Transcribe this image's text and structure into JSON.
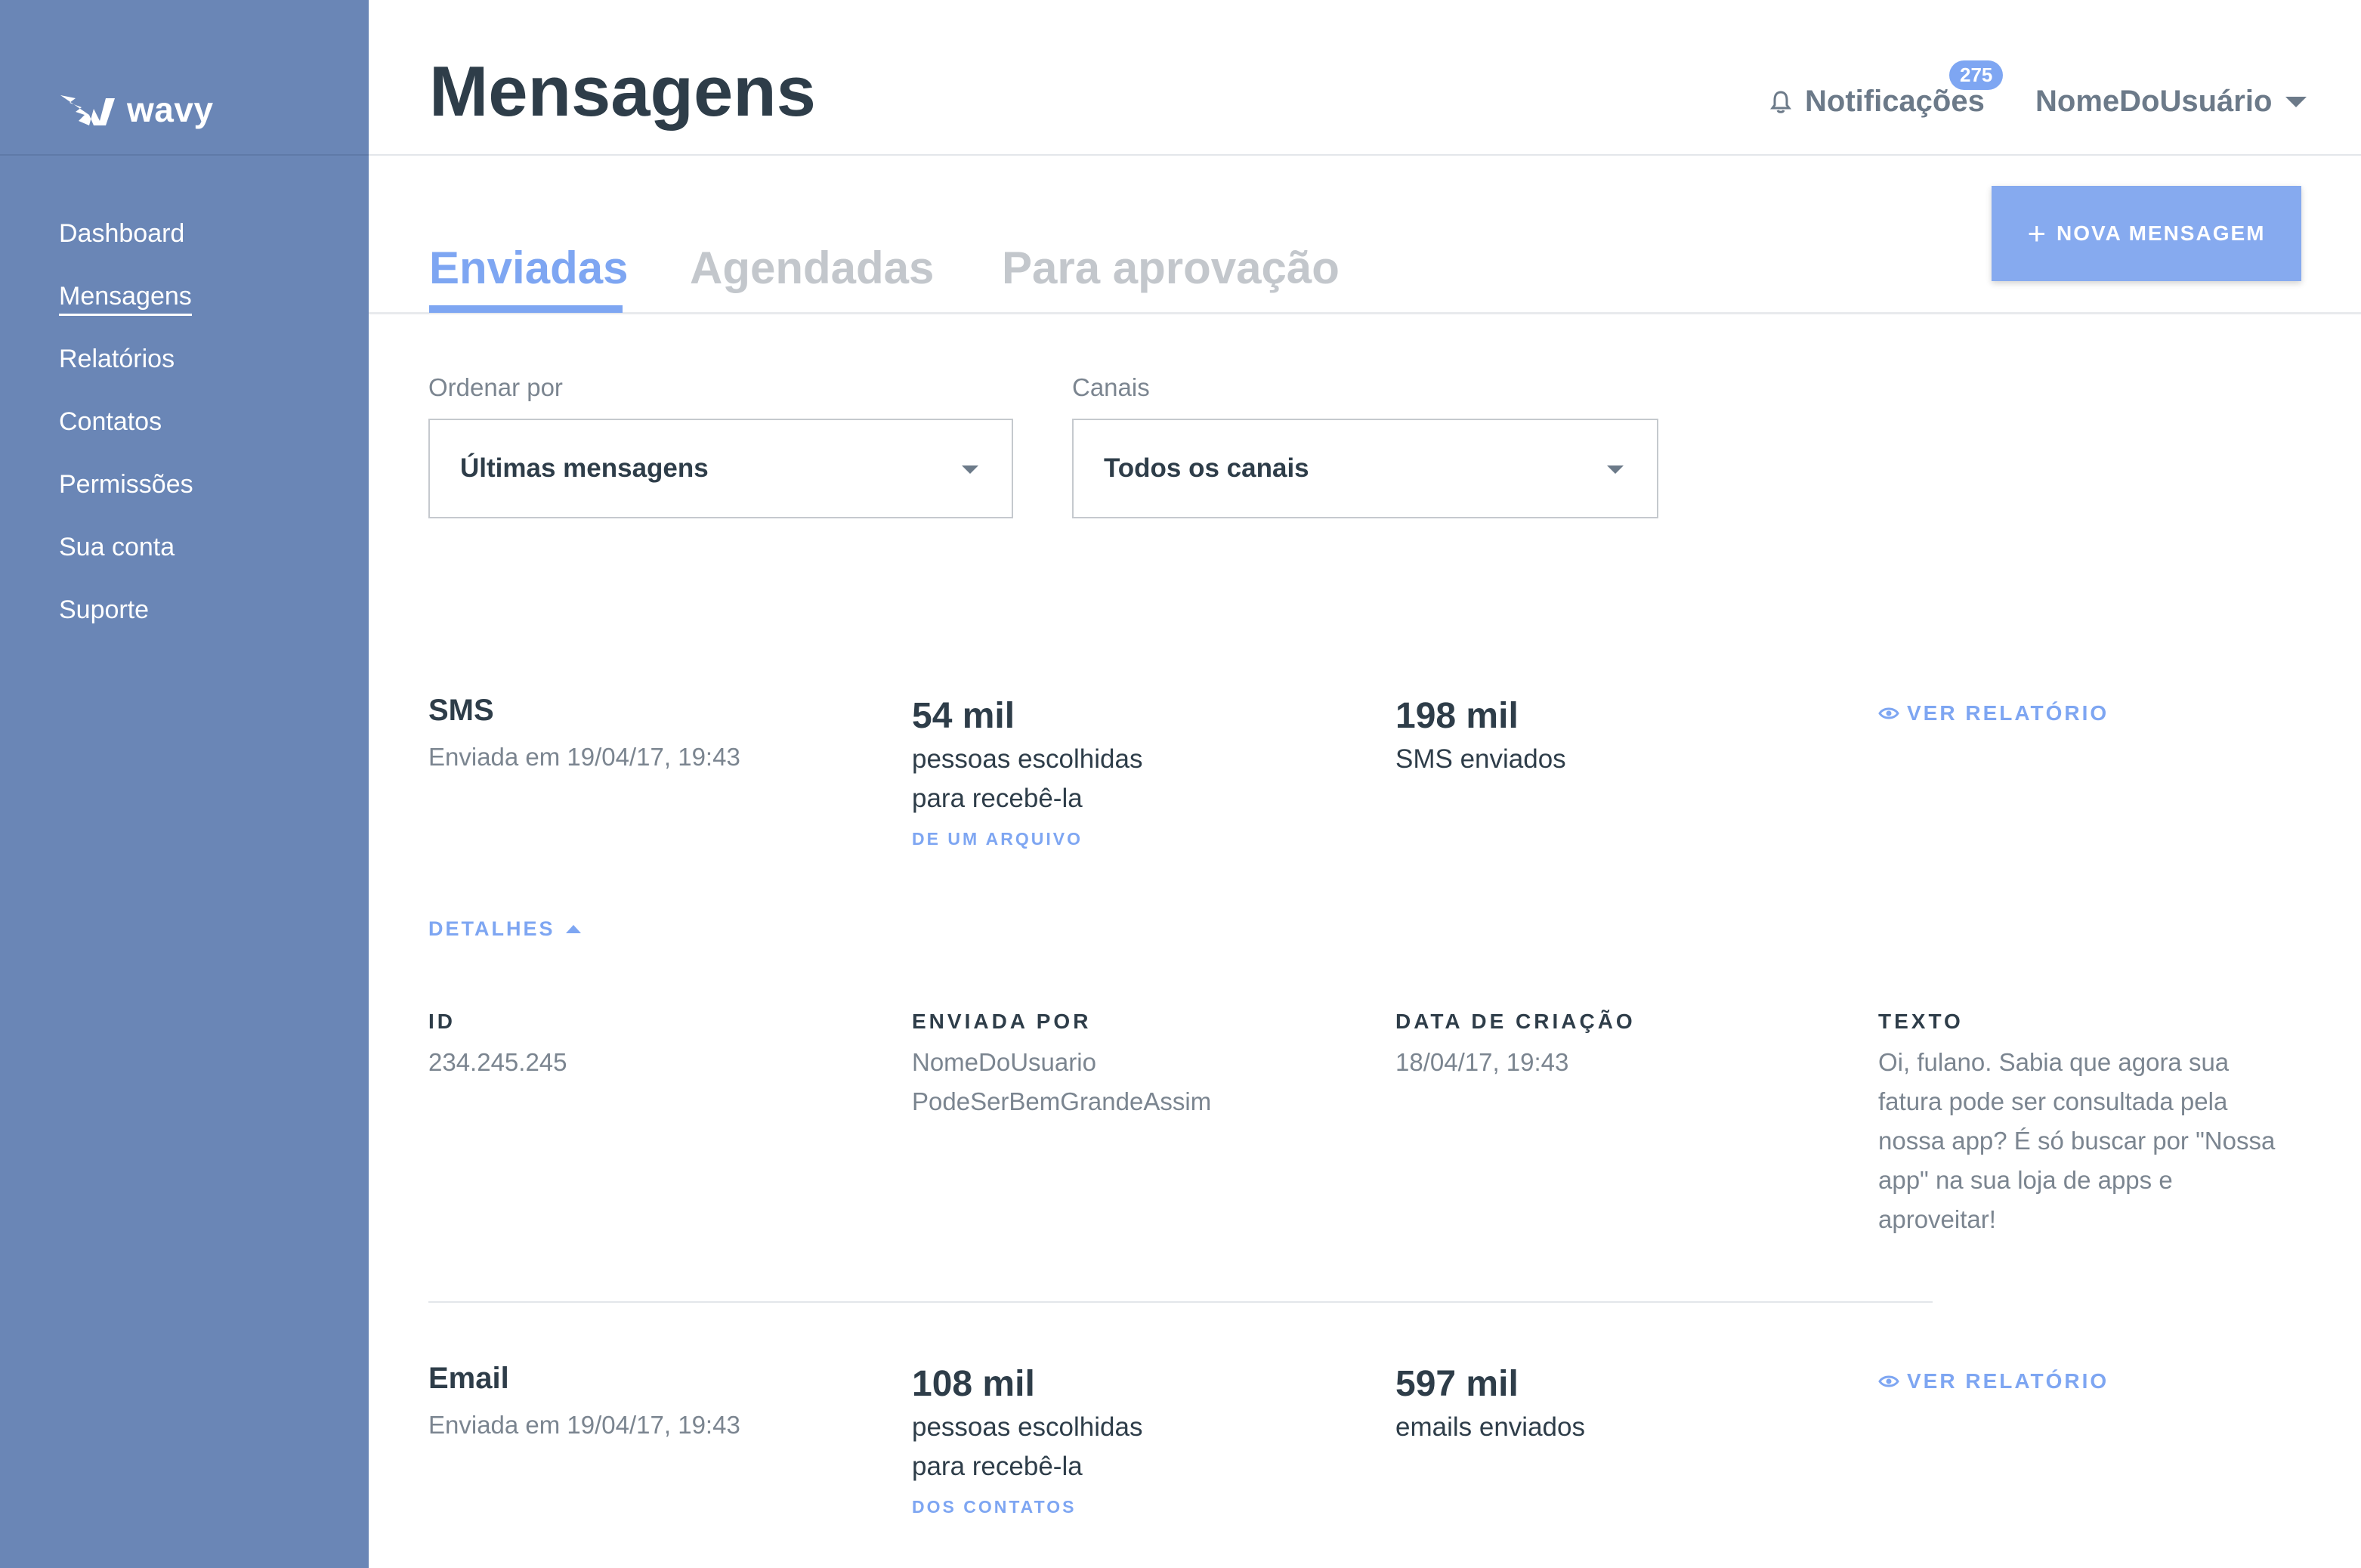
{
  "brand": {
    "name": "wavy"
  },
  "sidebar": {
    "items": [
      {
        "label": "Dashboard"
      },
      {
        "label": "Mensagens"
      },
      {
        "label": "Relatórios"
      },
      {
        "label": "Contatos"
      },
      {
        "label": "Permissões"
      },
      {
        "label": "Sua conta"
      },
      {
        "label": "Suporte"
      }
    ],
    "active_index": 1
  },
  "header": {
    "title": "Mensagens",
    "notifications_label": "Notificações",
    "notifications_count": "275",
    "username": "NomeDoUsuário"
  },
  "tabs": [
    {
      "label": "Enviadas",
      "active": true
    },
    {
      "label": "Agendadas",
      "active": false
    },
    {
      "label": "Para aprovação",
      "active": false
    }
  ],
  "new_message_button": "NOVA MENSAGEM",
  "filters": {
    "order": {
      "label": "Ordenar por",
      "value": "Últimas mensagens"
    },
    "channels": {
      "label": "Canais",
      "value": "Todos os canais"
    }
  },
  "messages": [
    {
      "channel": "SMS",
      "sent_at": "Enviada em 19/04/17, 19:43",
      "recipients": "54 mil",
      "recipients_desc_1": "pessoas escolhidas",
      "recipients_desc_2": "para recebê-la",
      "source": "DE UM ARQUIVO",
      "sent_count": "198 mil",
      "sent_desc": "SMS enviados",
      "report_link": "VER RELATÓRIO"
    },
    {
      "channel": "Email",
      "sent_at": "Enviada em 19/04/17, 19:43",
      "recipients": "108 mil",
      "recipients_desc_1": "pessoas escolhidas",
      "recipients_desc_2": "para recebê-la",
      "source": "DOS CONTATOS",
      "sent_count": "597 mil",
      "sent_desc": "emails enviados",
      "report_link": "VER RELATÓRIO"
    }
  ],
  "details": {
    "toggle_label": "DETALHES",
    "id_label": "ID",
    "id_value": "234.245.245",
    "sent_by_label": "ENVIADA POR",
    "sent_by_line1": "NomeDoUsuario",
    "sent_by_line2": "PodeSerBemGrandeAssim",
    "created_label": "DATA DE CRIAÇÃO",
    "created_value": "18/04/17, 19:43",
    "text_label": "TEXTO",
    "text_lines": [
      "Oi, fulano. Sabia que agora sua",
      "fatura pode ser consultada pela",
      "nossa app? É só buscar por \"Nossa",
      "app\" na sua loja de apps e",
      "aproveitar!"
    ]
  },
  "colors": {
    "sidebar": "#6a86b6",
    "accent": "#7ea6f2",
    "text_dark": "#2e3d49",
    "text_muted": "#7b8590"
  }
}
